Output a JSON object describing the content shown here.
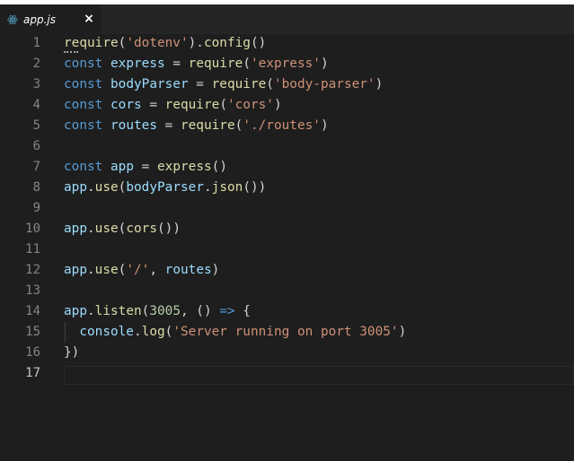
{
  "tab": {
    "filename": "app.js",
    "close_glyph": "×",
    "icon": "react-atom-icon",
    "icon_color": "#519aba"
  },
  "editor": {
    "active_line": 17,
    "lines": [
      {
        "n": "1",
        "tokens": [
          [
            "f",
            "require"
          ],
          [
            "p",
            "("
          ],
          [
            "s",
            "'dotenv'"
          ],
          [
            "p",
            ")."
          ],
          [
            "f",
            "config"
          ],
          [
            "p",
            "()"
          ]
        ]
      },
      {
        "n": "2",
        "tokens": [
          [
            "k",
            "const"
          ],
          [
            "p",
            " "
          ],
          [
            "v",
            "express"
          ],
          [
            "p",
            " = "
          ],
          [
            "f",
            "require"
          ],
          [
            "p",
            "("
          ],
          [
            "s",
            "'express'"
          ],
          [
            "p",
            ")"
          ]
        ]
      },
      {
        "n": "3",
        "tokens": [
          [
            "k",
            "const"
          ],
          [
            "p",
            " "
          ],
          [
            "v",
            "bodyParser"
          ],
          [
            "p",
            " = "
          ],
          [
            "f",
            "require"
          ],
          [
            "p",
            "("
          ],
          [
            "s",
            "'body-parser'"
          ],
          [
            "p",
            ")"
          ]
        ]
      },
      {
        "n": "4",
        "tokens": [
          [
            "k",
            "const"
          ],
          [
            "p",
            " "
          ],
          [
            "v",
            "cors"
          ],
          [
            "p",
            " = "
          ],
          [
            "f",
            "require"
          ],
          [
            "p",
            "("
          ],
          [
            "s",
            "'cors'"
          ],
          [
            "p",
            ")"
          ]
        ]
      },
      {
        "n": "5",
        "tokens": [
          [
            "k",
            "const"
          ],
          [
            "p",
            " "
          ],
          [
            "v",
            "routes"
          ],
          [
            "p",
            " = "
          ],
          [
            "f",
            "require"
          ],
          [
            "p",
            "("
          ],
          [
            "s",
            "'./routes'"
          ],
          [
            "p",
            ")"
          ]
        ]
      },
      {
        "n": "6",
        "tokens": []
      },
      {
        "n": "7",
        "tokens": [
          [
            "k",
            "const"
          ],
          [
            "p",
            " "
          ],
          [
            "v",
            "app"
          ],
          [
            "p",
            " = "
          ],
          [
            "f",
            "express"
          ],
          [
            "p",
            "()"
          ]
        ]
      },
      {
        "n": "8",
        "tokens": [
          [
            "v",
            "app"
          ],
          [
            "p",
            "."
          ],
          [
            "f",
            "use"
          ],
          [
            "p",
            "("
          ],
          [
            "v",
            "bodyParser"
          ],
          [
            "p",
            "."
          ],
          [
            "f",
            "json"
          ],
          [
            "p",
            "())"
          ]
        ]
      },
      {
        "n": "9",
        "tokens": []
      },
      {
        "n": "10",
        "tokens": [
          [
            "v",
            "app"
          ],
          [
            "p",
            "."
          ],
          [
            "f",
            "use"
          ],
          [
            "p",
            "("
          ],
          [
            "f",
            "cors"
          ],
          [
            "p",
            "())"
          ]
        ]
      },
      {
        "n": "11",
        "tokens": []
      },
      {
        "n": "12",
        "tokens": [
          [
            "v",
            "app"
          ],
          [
            "p",
            "."
          ],
          [
            "f",
            "use"
          ],
          [
            "p",
            "("
          ],
          [
            "s",
            "'/'"
          ],
          [
            "p",
            ", "
          ],
          [
            "v",
            "routes"
          ],
          [
            "p",
            ")"
          ]
        ]
      },
      {
        "n": "13",
        "tokens": []
      },
      {
        "n": "14",
        "tokens": [
          [
            "v",
            "app"
          ],
          [
            "p",
            "."
          ],
          [
            "f",
            "listen"
          ],
          [
            "p",
            "("
          ],
          [
            "n",
            "3005"
          ],
          [
            "p",
            ", () "
          ],
          [
            "k",
            "=>"
          ],
          [
            "p",
            " {"
          ]
        ]
      },
      {
        "n": "15",
        "tokens": [
          [
            "p",
            "  "
          ],
          [
            "v",
            "console"
          ],
          [
            "p",
            "."
          ],
          [
            "f",
            "log"
          ],
          [
            "p",
            "("
          ],
          [
            "s",
            "'Server running on port 3005'"
          ],
          [
            "p",
            ")"
          ]
        ]
      },
      {
        "n": "16",
        "tokens": [
          [
            "p",
            "})"
          ]
        ]
      },
      {
        "n": "17",
        "tokens": []
      }
    ]
  },
  "colors": {
    "background": "#1e1e1e",
    "keyword": "#569cd6",
    "function": "#dcdcaa",
    "string": "#ce9178",
    "variable": "#9cdcfe",
    "number": "#b5cea8",
    "line_number": "#858585",
    "active_line_number": "#c6c6c6"
  }
}
